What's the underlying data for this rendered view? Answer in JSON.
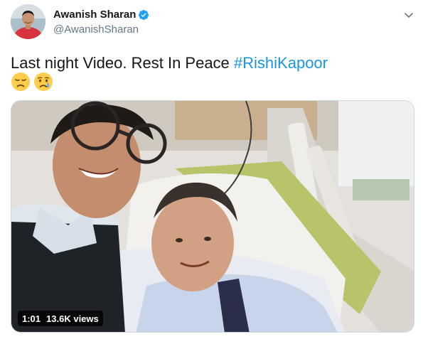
{
  "tweet": {
    "author": {
      "display_name": "Awanish Sharan",
      "handle": "@AwanishSharan",
      "verified": true,
      "avatar_icon": "profile-photo"
    },
    "menu_icon": "chevron-down-icon",
    "text": {
      "body": "Last night Video. Rest In Peace ",
      "hashtag": "#RishiKapoor",
      "emojis": [
        "disappointed-face-emoji",
        "crying-face-emoji"
      ]
    },
    "media": {
      "type": "video",
      "duration": "1:01",
      "views": "13.6K views"
    }
  },
  "colors": {
    "link": "#1b95e0",
    "primary_text": "#14171a",
    "secondary_text": "#657786",
    "verified_badge": "#1da1f2"
  }
}
